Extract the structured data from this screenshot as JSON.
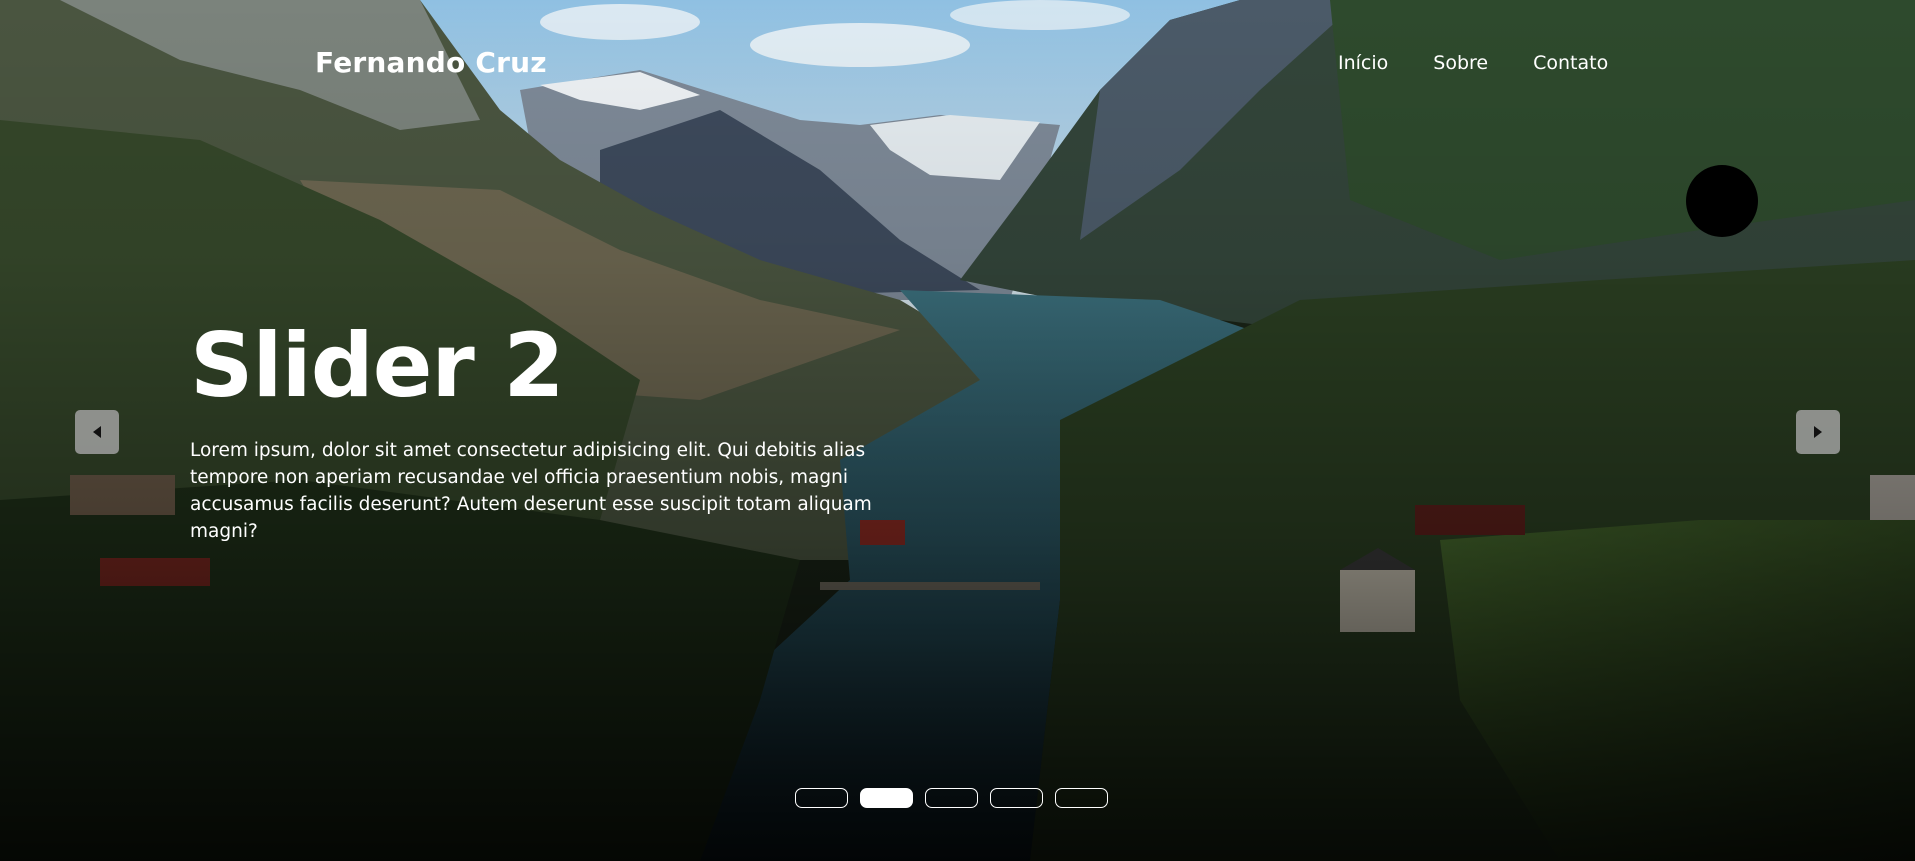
{
  "header": {
    "brand": "Fernando Cruz",
    "nav": [
      {
        "label": "Início"
      },
      {
        "label": "Sobre"
      },
      {
        "label": "Contato"
      }
    ]
  },
  "slider": {
    "title": "Slider 2",
    "text": "Lorem ipsum, dolor sit amet consectetur adipisicing elit. Qui debitis alias tempore non aperiam recusandae vel officia praesentium nobis, magni accusamus facilis deserunt? Autem deserunt esse suscipit totam aliquam magni?",
    "slide_count": 5,
    "active_slide": 2,
    "prev_icon": "caret-left-icon",
    "next_icon": "caret-right-icon"
  },
  "background": {
    "description_icon": "mountain-lake-photo",
    "sky": "#a9cbe0",
    "water": "#2c5a66",
    "forest": "#2f4a25"
  }
}
